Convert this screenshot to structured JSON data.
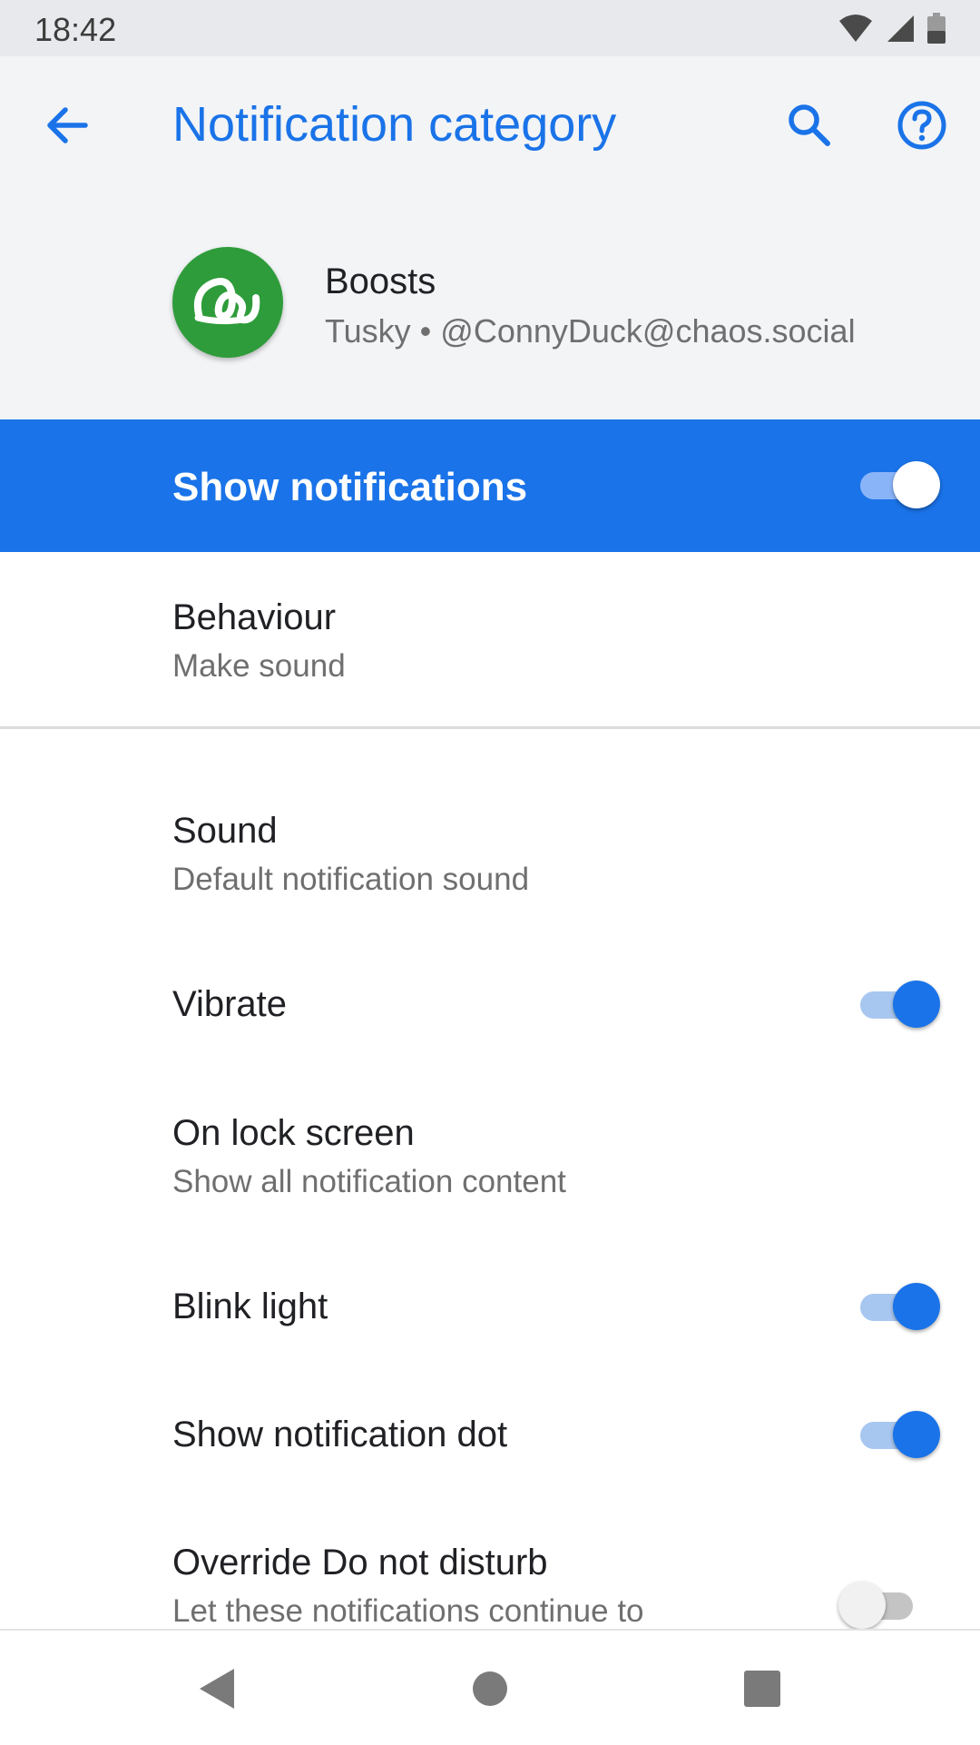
{
  "status_bar": {
    "time": "18:42",
    "icons": [
      "wifi-icon",
      "signal-icon",
      "battery-icon"
    ]
  },
  "app_bar": {
    "title": "Notification category",
    "back_icon": "arrow-back-icon",
    "search_icon": "search-icon",
    "help_icon": "help-icon"
  },
  "channel": {
    "name": "Boosts",
    "subtitle": "Tusky • @ConnyDuck@chaos.social",
    "logo_icon": "tusky-logo-icon",
    "logo_color": "#2e9c3a"
  },
  "master_switch": {
    "label": "Show notifications",
    "enabled": true,
    "background": "#1a73e8"
  },
  "settings": [
    {
      "title": "Behaviour",
      "subtitle": "Make sound"
    },
    {
      "title": "Sound",
      "subtitle": "Default notification sound"
    },
    {
      "title": "Vibrate",
      "toggle": true
    },
    {
      "title": "On lock screen",
      "subtitle": "Show all notification content"
    },
    {
      "title": "Blink light",
      "toggle": true
    },
    {
      "title": "Show notification dot",
      "toggle": true
    },
    {
      "title": "Override Do not disturb",
      "subtitle": "Let these notifications continue to",
      "toggle": false
    }
  ],
  "nav_bar": {
    "icons": [
      "nav-back-icon",
      "nav-home-icon",
      "nav-recents-icon"
    ]
  },
  "colors": {
    "accent": "#1a73e8"
  }
}
